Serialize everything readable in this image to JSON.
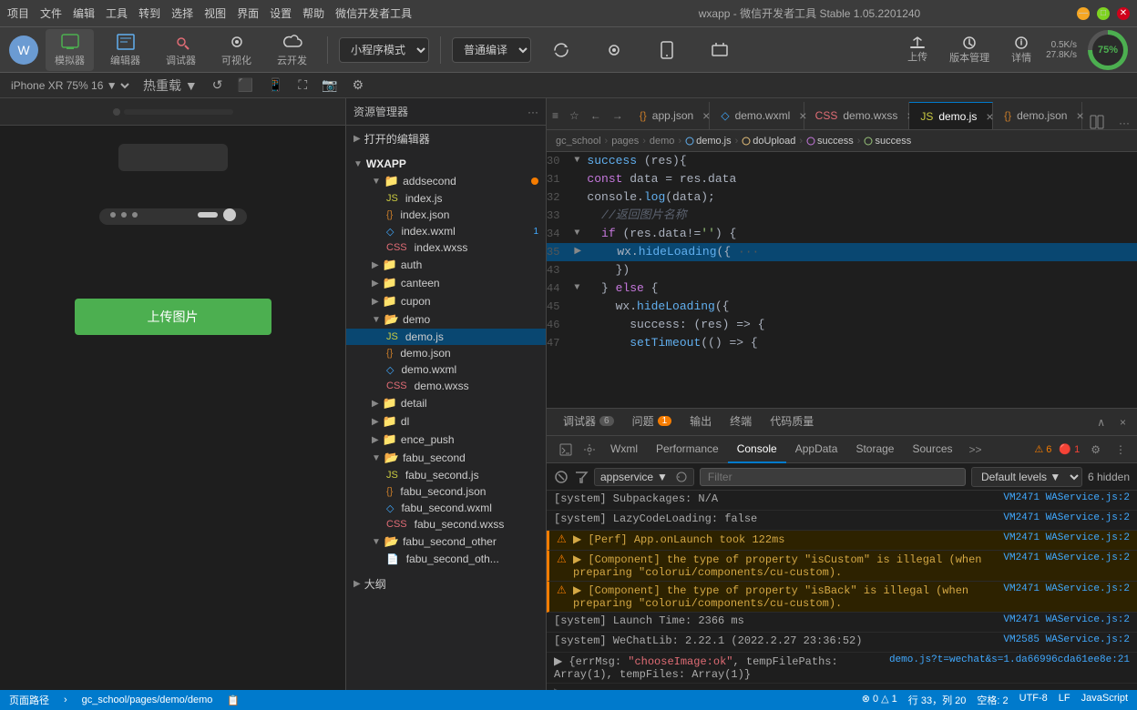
{
  "titlebar": {
    "menu": [
      "项目",
      "文件",
      "编辑",
      "工具",
      "转到",
      "选择",
      "视图",
      "界面",
      "设置",
      "帮助",
      "微信开发者工具"
    ],
    "title": "wxapp - 微信开发者工具 Stable 1.05.2201240",
    "min": "—",
    "max": "□",
    "close": "✕"
  },
  "toolbar": {
    "simulator_label": "模拟器",
    "editor_label": "编辑器",
    "debugger_label": "调试器",
    "visual_label": "可视化",
    "cloud_label": "云开发",
    "mode_label": "小程序模式",
    "compile_label": "普通编译",
    "refresh_label": "编译",
    "preview_label": "预览",
    "realtest_label": "真机调试",
    "cache_label": "清缓存",
    "upload_label": "上传",
    "version_label": "版本管理",
    "detail_label": "详情",
    "speed_up": "0.5K/s",
    "speed_down": "27.8K/s",
    "percent": "75%"
  },
  "devicebar": {
    "device": "iPhone XR 75% 16 ▼",
    "hotreload": "热重载 ▼"
  },
  "simulator": {
    "upload_btn": "上传图片"
  },
  "explorer": {
    "title": "资源管理器",
    "opened_editors": "打开的编辑器",
    "wxapp": "WXAPP",
    "items": [
      {
        "name": "addsecond",
        "type": "folder",
        "badge": "dot"
      },
      {
        "name": "index.js",
        "type": "js",
        "indent": 2
      },
      {
        "name": "index.json",
        "type": "json",
        "indent": 2
      },
      {
        "name": "index.wxml",
        "type": "wxml",
        "indent": 2,
        "badge": "1"
      },
      {
        "name": "index.wxss",
        "type": "wxss",
        "indent": 2
      },
      {
        "name": "auth",
        "type": "folder",
        "indent": 1
      },
      {
        "name": "canteen",
        "type": "folder",
        "indent": 1
      },
      {
        "name": "cupon",
        "type": "folder",
        "indent": 1
      },
      {
        "name": "demo",
        "type": "folder",
        "indent": 1,
        "active": true
      },
      {
        "name": "demo.js",
        "type": "js",
        "indent": 2,
        "active": true
      },
      {
        "name": "demo.json",
        "type": "json",
        "indent": 2
      },
      {
        "name": "demo.wxml",
        "type": "wxml",
        "indent": 2
      },
      {
        "name": "demo.wxss",
        "type": "wxss",
        "indent": 2
      },
      {
        "name": "detail",
        "type": "folder",
        "indent": 1
      },
      {
        "name": "dl",
        "type": "folder",
        "indent": 1
      },
      {
        "name": "ence_push",
        "type": "folder",
        "indent": 1
      },
      {
        "name": "fabu_second",
        "type": "folder",
        "indent": 1
      },
      {
        "name": "fabu_second.js",
        "type": "js",
        "indent": 2
      },
      {
        "name": "fabu_second.json",
        "type": "json",
        "indent": 2
      },
      {
        "name": "fabu_second.wxml",
        "type": "wxml",
        "indent": 2
      },
      {
        "name": "fabu_second.wxss",
        "type": "wxss",
        "indent": 2
      },
      {
        "name": "fabu_second_other",
        "type": "folder",
        "indent": 1
      },
      {
        "name": "fabu_second_oth...",
        "type": "file",
        "indent": 2
      },
      {
        "name": "大纲",
        "type": "section"
      }
    ]
  },
  "editor": {
    "tabs": [
      {
        "name": "app.json",
        "type": "json",
        "active": false
      },
      {
        "name": "demo.wxml",
        "type": "wxml",
        "active": false
      },
      {
        "name": "demo.wxss",
        "type": "wxss",
        "active": false
      },
      {
        "name": "demo.js",
        "type": "js",
        "active": true
      },
      {
        "name": "demo.json",
        "type": "json",
        "active": false
      }
    ],
    "breadcrumb": [
      "gc_school",
      "pages",
      "demo",
      "demo.js",
      "doUpload",
      "success",
      "success"
    ],
    "lines": [
      {
        "num": 30,
        "arrow": "▼",
        "content": "success",
        "parts": [
          {
            "text": "success ",
            "class": "kw-blue"
          },
          {
            "text": "(res)",
            "class": "kw-white"
          },
          {
            "text": "{",
            "class": "kw-white"
          }
        ]
      },
      {
        "num": 31,
        "arrow": " ",
        "content": "const data = res.data",
        "parts": [
          {
            "text": "  const ",
            "class": "kw-purple"
          },
          {
            "text": "data ",
            "class": "kw-white"
          },
          {
            "text": "= ",
            "class": "kw-white"
          },
          {
            "text": "res.data",
            "class": "kw-yellow"
          }
        ]
      },
      {
        "num": 32,
        "arrow": " ",
        "content": "console.log(data);",
        "parts": [
          {
            "text": "  console.",
            "class": "kw-white"
          },
          {
            "text": "log",
            "class": "kw-blue"
          },
          {
            "text": "(data);",
            "class": "kw-white"
          }
        ]
      },
      {
        "num": 33,
        "arrow": " ",
        "content": "//返回图片名称",
        "parts": [
          {
            "text": "  //返回图片名称",
            "class": "kw-comment"
          }
        ]
      },
      {
        "num": 34,
        "arrow": "▼",
        "content": "if (res.data!='') {",
        "parts": [
          {
            "text": "  if ",
            "class": "kw-purple"
          },
          {
            "text": "(res.data!=",
            "class": "kw-white"
          },
          {
            "text": "''",
            "class": "kw-green"
          },
          {
            "text": ") {",
            "class": "kw-white"
          }
        ]
      },
      {
        "num": 35,
        "arrow": "▶",
        "content": "wx.hideLoading({···",
        "parts": [
          {
            "text": "    wx.",
            "class": "kw-white"
          },
          {
            "text": "hideLoading",
            "class": "kw-blue"
          },
          {
            "text": "({···",
            "class": "kw-white"
          }
        ],
        "collapsed": true,
        "highlight": true
      },
      {
        "num": 43,
        "arrow": " ",
        "content": "})",
        "parts": [
          {
            "text": "    })",
            "class": "kw-white"
          }
        ]
      },
      {
        "num": 44,
        "arrow": "▼",
        "content": "} else {",
        "parts": [
          {
            "text": "  } ",
            "class": "kw-white"
          },
          {
            "text": "else ",
            "class": "kw-purple"
          },
          {
            "text": "{",
            "class": "kw-white"
          }
        ]
      },
      {
        "num": 45,
        "arrow": " ",
        "content": "wx.hideLoading({",
        "parts": [
          {
            "text": "    wx.",
            "class": "kw-white"
          },
          {
            "text": "hideLoading",
            "class": "kw-blue"
          },
          {
            "text": "({",
            "class": "kw-white"
          }
        ]
      },
      {
        "num": 46,
        "arrow": " ",
        "content": "success: (res) => {",
        "parts": [
          {
            "text": "      success: ",
            "class": "kw-white"
          },
          {
            "text": "(res) => {",
            "class": "kw-white"
          }
        ]
      },
      {
        "num": 47,
        "arrow": " ",
        "content": "setTimeout(() => {",
        "parts": [
          {
            "text": "      ",
            "class": "kw-white"
          },
          {
            "text": "setTimeout",
            "class": "kw-blue"
          },
          {
            "text": "(() => {",
            "class": "kw-white"
          }
        ]
      }
    ]
  },
  "devtools": {
    "tabs": [
      {
        "name": "调试器",
        "badge": "6",
        "active": false
      },
      {
        "name": "问题",
        "badge": "1",
        "badge_warn": true,
        "active": false
      },
      {
        "name": "输出",
        "active": false
      },
      {
        "name": "终端",
        "active": false
      },
      {
        "name": "代码质量",
        "active": false
      }
    ],
    "subtabs": [
      {
        "name": "Wxml",
        "active": false
      },
      {
        "name": "Performance",
        "active": false
      },
      {
        "name": "Console",
        "active": true
      },
      {
        "name": "AppData",
        "active": false
      },
      {
        "name": "Storage",
        "active": false
      },
      {
        "name": "Sources",
        "active": false
      }
    ],
    "console_toolbar": {
      "context": "appservice",
      "filter_placeholder": "Filter",
      "levels": "Default levels ▼",
      "hidden": "6 hidden"
    },
    "warn_count": "⚠ 6",
    "error_count": "🔴 1",
    "console_lines": [
      {
        "type": "system",
        "text": "[system] Subpackages: N/A",
        "source": "VM2471 WAService.js:2"
      },
      {
        "type": "system",
        "text": "[system] LazyCodeLoading: false",
        "source": "VM2471 WAService.js:2"
      },
      {
        "type": "warn",
        "text": "▶ [Perf] App.onLaunch took 122ms",
        "source": "VM2471 WAService.js:2"
      },
      {
        "type": "warn",
        "text": "▶ [Component] the type of property \"isCustom\" is illegal (when preparing \"colorui/components/cu-custom).",
        "source": "VM2471 WAService.js:2"
      },
      {
        "type": "warn",
        "text": "▶ [Component] the type of property \"isBack\" is illegal (when preparing \"colorui/components/cu-custom).",
        "source": "VM2471 WAService.js:2"
      },
      {
        "type": "system",
        "text": "[system] Launch Time: 2366 ms",
        "source": "VM2471 WAService.js:2"
      },
      {
        "type": "system",
        "text": "[system] WeChatLib: 2.22.1 (2022.2.27 23:36:52)",
        "source": "VM2585 WAService.js:2"
      },
      {
        "type": "result",
        "text": "▶ {errMsg: \"chooseImage:ok\", tempFilePaths: Array(1), tempFiles: Array(1)}",
        "source": "demo.js?t=wechat&s=1.da66996cda61ee8e:21"
      }
    ]
  },
  "statusbar": {
    "path_label": "页面路径",
    "path": "gc_school/pages/demo/demo",
    "errors": "⊗ 0 △ 1",
    "line_col": "行 33，列 20",
    "spaces": "空格: 2",
    "encoding": "UTF-8",
    "line_ending": "LF",
    "language": "JavaScript"
  }
}
